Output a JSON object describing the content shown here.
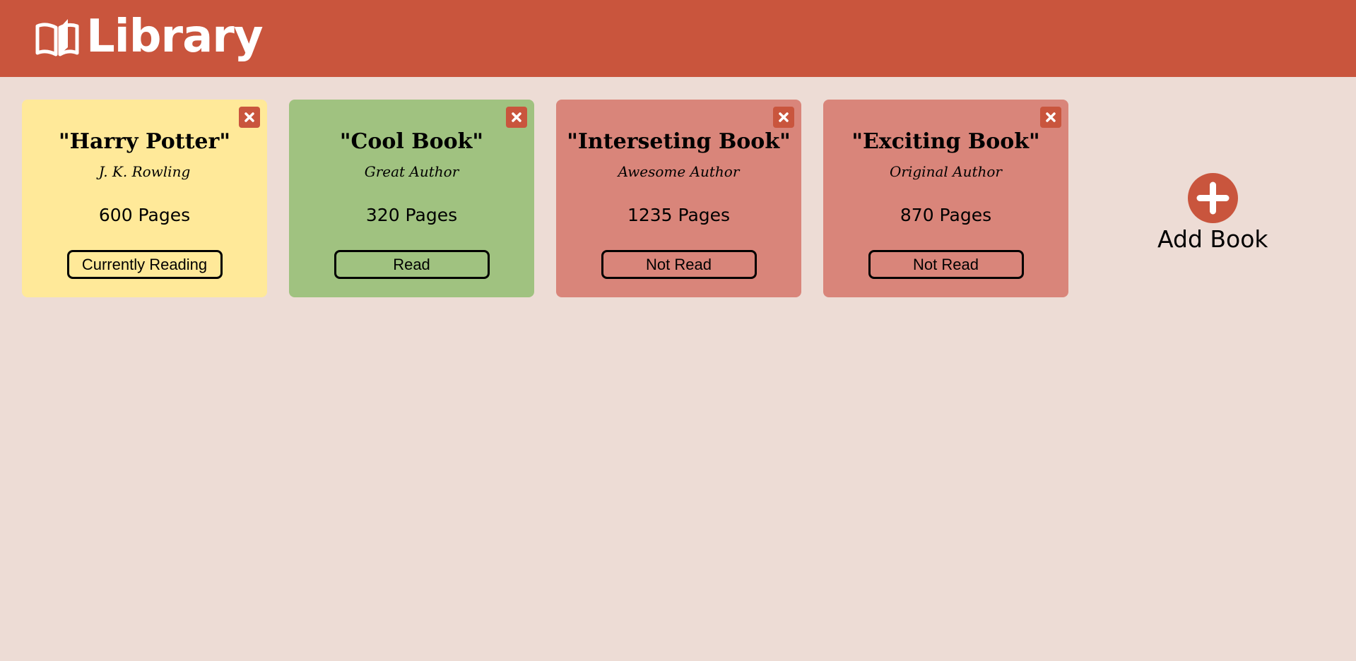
{
  "app": {
    "title": "Library",
    "logo_icon": "open-book-icon"
  },
  "colors": {
    "header": "#c9553d",
    "background": "#eddcd5",
    "reading": "#ffe999",
    "read": "#a0c280",
    "not_read": "#d9857a",
    "accent": "#c9553d"
  },
  "books": [
    {
      "title": "\"Harry Potter\"",
      "author": "J. K. Rowling",
      "pages": "600 Pages",
      "status": "Currently Reading",
      "color": "#ffe999"
    },
    {
      "title": "\"Cool Book\"",
      "author": "Great Author",
      "pages": "320 Pages",
      "status": "Read",
      "color": "#a0c280"
    },
    {
      "title": "\"Interseting Book\"",
      "author": "Awesome Author",
      "pages": "1235 Pages",
      "status": "Not Read",
      "color": "#d9857a"
    },
    {
      "title": "\"Exciting Book\"",
      "author": "Original Author",
      "pages": "870 Pages",
      "status": "Not Read",
      "color": "#d9857a"
    }
  ],
  "add_book": {
    "label": "Add Book",
    "icon": "plus-circle-icon"
  }
}
